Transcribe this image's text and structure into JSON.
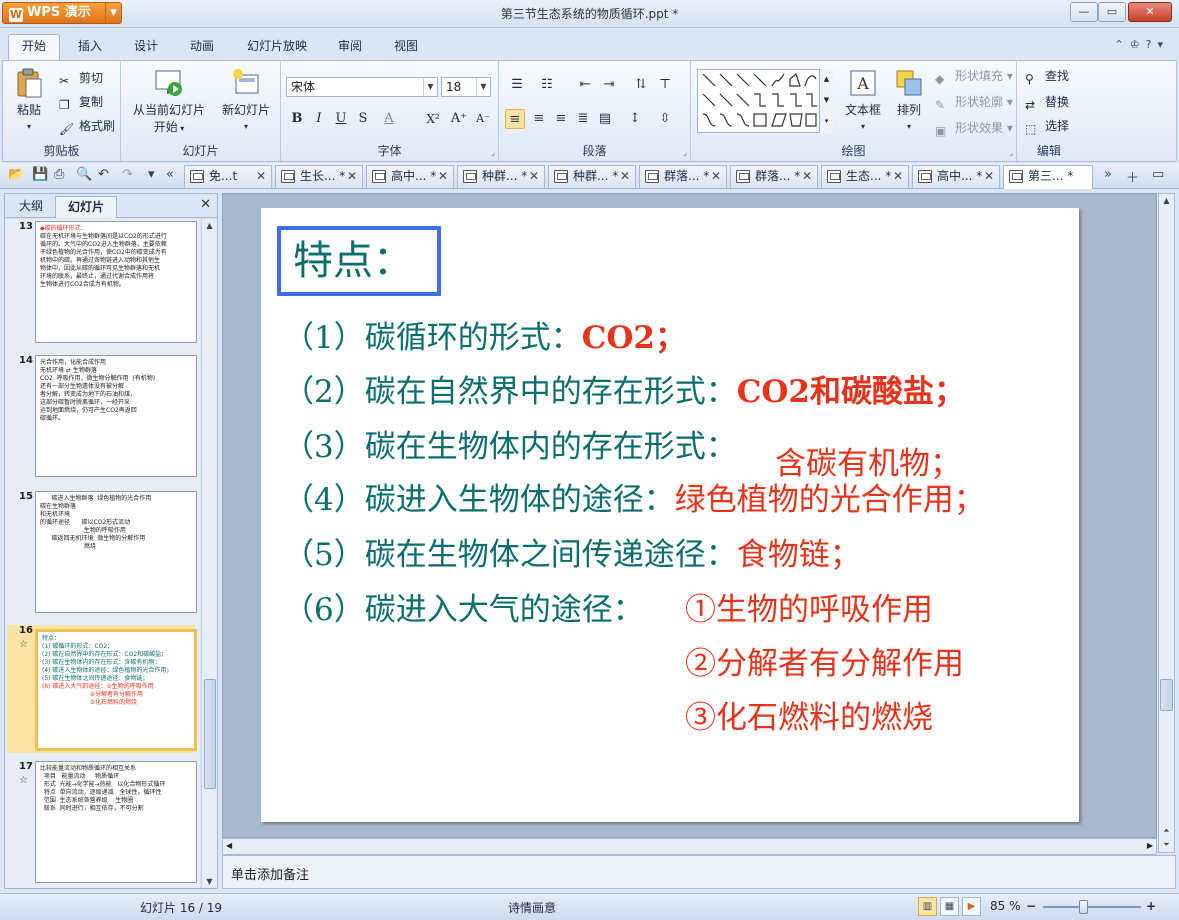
{
  "window": {
    "app_button": "WPS 演示",
    "title": "第三节生态系统的物质循环.ppt *",
    "minimize": "—",
    "restore": "▭",
    "close": "✕"
  },
  "ribbon_tabs": [
    "开始",
    "插入",
    "设计",
    "动画",
    "幻灯片放映",
    "审阅",
    "视图"
  ],
  "ribbon": {
    "clipboard": {
      "label": "剪贴板",
      "paste": "粘贴",
      "cut": "剪切",
      "copy": "复制",
      "format_painter": "格式刷"
    },
    "slides": {
      "label": "幻灯片",
      "from_current_line1": "从当前幻灯片",
      "from_current_line2": "开始",
      "new_slide": "新幻灯片"
    },
    "font": {
      "label": "字体",
      "name": "宋体",
      "size": "18"
    },
    "paragraph": {
      "label": "段落"
    },
    "drawing": {
      "label": "绘图",
      "textbox": "文本框",
      "arrange": "排列",
      "shape_fill": "形状填充",
      "shape_outline": "形状轮廓",
      "shape_effect": "形状效果"
    },
    "edit": {
      "label": "编辑",
      "find": "查找",
      "replace": "替换",
      "select": "选择"
    }
  },
  "doc_tabs": [
    {
      "label": "免...t",
      "active": false
    },
    {
      "label": "生长... *",
      "active": false
    },
    {
      "label": "高中... *",
      "active": false
    },
    {
      "label": "种群... *",
      "active": false
    },
    {
      "label": "种群... *",
      "active": false
    },
    {
      "label": "群落... *",
      "active": false
    },
    {
      "label": "群落... *",
      "active": false
    },
    {
      "label": "生态... *",
      "active": false
    },
    {
      "label": "高中... *",
      "active": false
    },
    {
      "label": "第三... *",
      "active": true
    }
  ],
  "left_pane": {
    "tab_outline": "大纲",
    "tab_slides": "幻灯片",
    "close": "✕",
    "thumbnails": [
      {
        "num": "13",
        "star": "",
        "lines": [
          "◆碳的循环形式：",
          "碳在无机环境与生物群落间是以CO2的形式进行",
          "循环的。大气中的CO2进入生物群落，主要依赖",
          "于绿色植物的光合作用，使CO2中的碳变成为有",
          "机物中的碳。再通过各物链进入动物和其他生",
          "物体中，因此从碳的循环可见生物群落和无机",
          "环境的联系，最终止，通过代谢合成作用将",
          "生物体进行CO2合成为有机物。"
        ]
      },
      {
        "num": "14",
        "star": "",
        "lines": [
          "光合作用，化能合成作用",
          "无机环境 ⇄ 生物群落",
          "CO2  呼吸作用，微生物分解作用  (有机物)",
          "",
          "还有一部分生物遗体没有被分解",
          "者分解，转变成为地下的石油和煤，",
          "这部分碳暂时脱离循环，一经开采",
          "运到地面燃烧，仍可产生CO2再返回",
          "碳循环。"
        ]
      },
      {
        "num": "15",
        "star": "",
        "lines": [
          "      碳进入生物群落  绿色植物的光合作用",
          "碳在生物群落",
          "和无机环境",
          "的循环途径      碳以CO2形式流动",
          "                       生物的呼吸作用",
          "      碳返回无机环境  微生物的分解作用",
          "                       燃烧"
        ]
      },
      {
        "num": "16",
        "star": "☆",
        "lines": [
          "特点：",
          "(1) 碳循环的形式：CO2；",
          "(2) 碳在自然界中的存在形式：CO2和碳酸盐；",
          "(3) 碳在生物体内的存在形式：含碳有机物；",
          "(4) 碳进入生物体的途径：绿色植物的光合作用；",
          "(5) 碳在生物体之间传递途径：食物链；",
          "(6) 碳进入大气的途径：①生物的呼吸作用",
          "                         ②分解者有分解作用",
          "                         ③化石燃料的燃烧"
        ]
      },
      {
        "num": "17",
        "star": "☆",
        "lines": [
          "比较能量流动和物质循环的相互关系",
          "  项目   能量流动     物质循环",
          "  形式  光能→化学能→热能   以化合物形式循环",
          "  特点  单向流动，逐级递减   全球性，循环性",
          "  范围  生态系统各营养级    生物圈",
          "  联系  同时进行，相互依存，不可分割"
        ]
      }
    ]
  },
  "slide": {
    "title": "特点：",
    "lines": [
      {
        "prefix": "（1）碳循环的形式：",
        "answer": "CO2；"
      },
      {
        "prefix": "（2）碳在自然界中的存在形式：",
        "answer": "CO2和碳酸盐；"
      },
      {
        "prefix": "（3）碳在生物体内的存在形式：",
        "answer": "含碳有机物；"
      },
      {
        "prefix": "（4）碳进入生物体的途径：",
        "answer": "绿色植物的光合作用；"
      },
      {
        "prefix": "（5）碳在生物体之间传递途径：",
        "answer": "食物链；"
      },
      {
        "prefix": "（6）碳进入大气的途径：",
        "answer": "①生物的呼吸作用"
      },
      {
        "prefix": "",
        "answer": "②分解者有分解作用"
      },
      {
        "prefix": "",
        "answer": "③化石燃料的燃烧"
      }
    ]
  },
  "notes": {
    "placeholder": "单击添加备注"
  },
  "status": {
    "slide_counter": "幻灯片 16 / 19",
    "theme": "诗情画意",
    "zoom": "85 %",
    "zoom_out": "−",
    "zoom_in": "+"
  }
}
